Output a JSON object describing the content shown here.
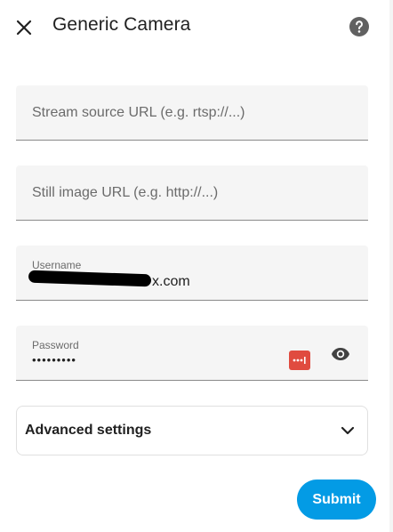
{
  "dialog": {
    "title": "Generic Camera",
    "close_icon": "close-icon",
    "help_icon": "help-circle-icon"
  },
  "form": {
    "stream_source": {
      "placeholder": "Stream source URL (e.g. rtsp://...)",
      "value": ""
    },
    "still_image": {
      "placeholder": "Still image URL (e.g. http://...)",
      "value": ""
    },
    "username": {
      "label": "Username",
      "value_suffix": "x.com"
    },
    "password": {
      "label": "Password",
      "masked_value": "•••••••••",
      "manager_icon": "password-manager-icon",
      "visibility_icon": "eye-icon"
    }
  },
  "advanced": {
    "label": "Advanced settings",
    "icon": "chevron-down-icon"
  },
  "actions": {
    "submit_label": "Submit"
  },
  "colors": {
    "accent": "#039be5",
    "password_manager": "#e04b3f",
    "field_bg": "#f5f5f5"
  }
}
